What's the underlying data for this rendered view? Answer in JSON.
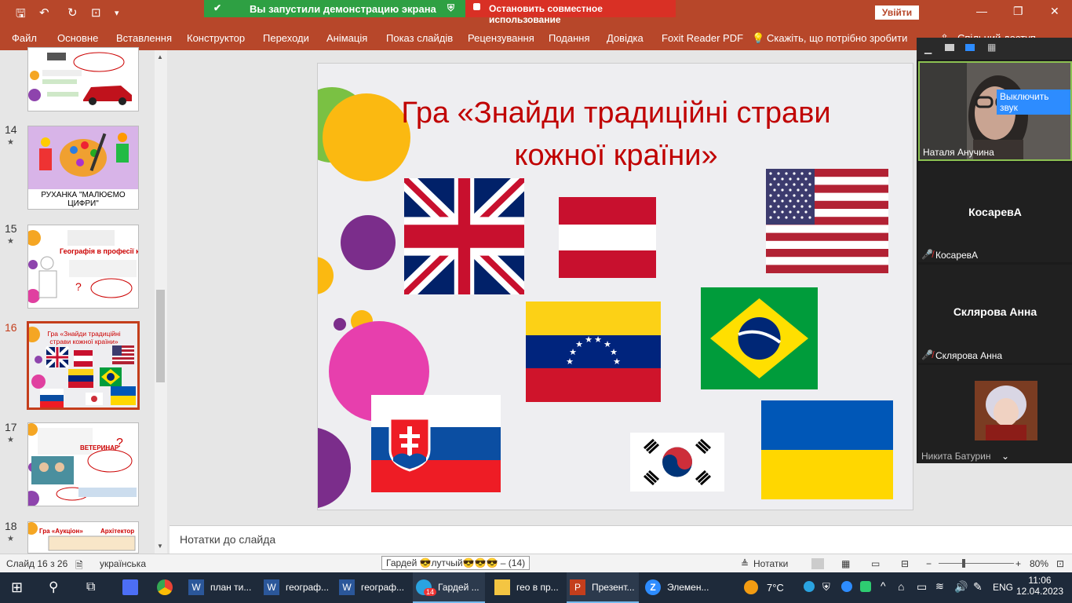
{
  "titlebar": {
    "share_status": "Вы запустили демонстрацию экрана",
    "stop_share": "Остановить совместное использование",
    "signin": "Увійти"
  },
  "ribbon": {
    "tabs": [
      "Файл",
      "Основне",
      "Вставлення",
      "Конструктор",
      "Переходи",
      "Анімація",
      "Показ слайдів",
      "Рецензування",
      "Подання",
      "Довідка",
      "Foxit Reader PDF"
    ],
    "tell_me": "Скажіть, що потрібно зробити",
    "share": "Спільний доступ"
  },
  "thumbnails": [
    {
      "num": "14",
      "caption": "РУХАНКА \"МАЛЮЄМО ЦИФРИ\""
    },
    {
      "num": "15",
      "caption": "Географія в професії кухаря"
    },
    {
      "num": "16",
      "caption": "Гра «Знайди традиційні страви кожної країни»"
    },
    {
      "num": "17",
      "caption": "ВЕТЕРИНАР"
    },
    {
      "num": "18",
      "caption": "Гра «Аукціон»",
      "caption2": "Архітектор"
    }
  ],
  "slide": {
    "title_line1": "Гра «Знайди традиційні страви",
    "title_line2": "кожної країни»"
  },
  "notes": {
    "placeholder": "Нотатки до слайда"
  },
  "status": {
    "slide_count": "Слайд 16 з 26",
    "language": "українська",
    "popup": "Гардей 😎лутчый😎😎😎 – (14)",
    "notes_btn": "Нотатки",
    "zoom": "80%"
  },
  "zoom_panel": {
    "unmute": "Выключить звук",
    "participants": [
      {
        "name": "Наталя Анучина"
      },
      {
        "name": "КосаревА",
        "big": "КосаревА"
      },
      {
        "name": "Склярова Анна",
        "big": "Склярова Анна"
      },
      {
        "name": "Никита Батурин"
      }
    ]
  },
  "taskbar": {
    "items": [
      "план ти...",
      "географ...",
      "географ...",
      "Гардей ...",
      "гео в пр...",
      "Презент...",
      "Элемен..."
    ],
    "weather": "7°C",
    "lang": "ENG",
    "time": "11:06",
    "date": "12.04.2023",
    "badge": "14"
  },
  "colors": {
    "accent": "#b7472a",
    "title_red": "#c00000",
    "selected": "#c43e1c"
  }
}
